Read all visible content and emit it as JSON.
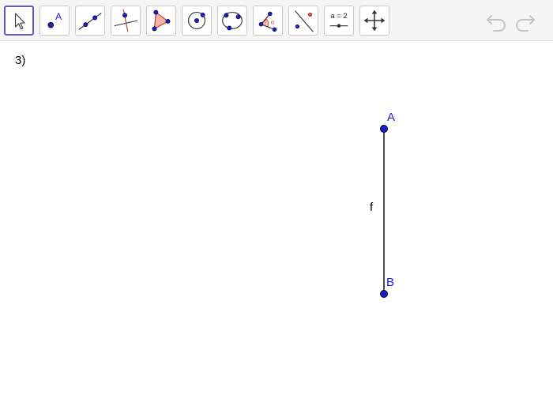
{
  "toolbar": {
    "tools": [
      {
        "name": "move-tool",
        "icon": "cursor-arrow-icon",
        "active": true
      },
      {
        "name": "point-tool",
        "icon": "point-icon",
        "icon_label": "A"
      },
      {
        "name": "line-tool",
        "icon": "line-through-two-points-icon"
      },
      {
        "name": "perpendicular-line-tool",
        "icon": "perpendicular-line-icon"
      },
      {
        "name": "polygon-tool",
        "icon": "polygon-icon"
      },
      {
        "name": "circle-center-point-tool",
        "icon": "circle-center-point-icon"
      },
      {
        "name": "circle-three-points-tool",
        "icon": "circle-three-points-icon"
      },
      {
        "name": "angle-tool",
        "icon": "angle-icon",
        "icon_label": "α"
      },
      {
        "name": "reflect-about-line-tool",
        "icon": "reflect-about-line-icon"
      },
      {
        "name": "slider-tool",
        "icon": "slider-icon",
        "icon_label": "a = 2"
      },
      {
        "name": "move-graphics-view-tool",
        "icon": "move-graphics-view-icon"
      }
    ],
    "undo_icon": "undo-icon",
    "redo_icon": "redo-icon"
  },
  "canvas": {
    "exercise_label": "3)",
    "points": [
      {
        "name": "A"
      },
      {
        "name": "B"
      }
    ],
    "segment": {
      "name": "f"
    }
  },
  "colors": {
    "point": "#1c1cd6",
    "segment": "#4d4d4d",
    "active_tool_border": "#6557d2"
  }
}
